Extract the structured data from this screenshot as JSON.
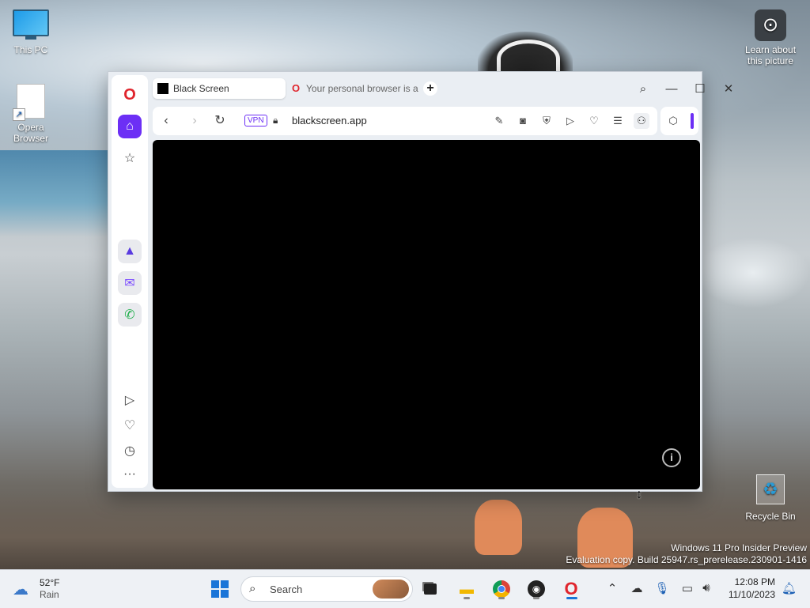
{
  "desktop": {
    "icons": [
      {
        "label": "This PC",
        "icon": "computer-icon"
      },
      {
        "label": "Opera Browser",
        "icon": "shortcut-file-icon"
      },
      {
        "label": "Learn about this picture",
        "icon": "learn-picture-icon"
      },
      {
        "label": "Recycle Bin",
        "icon": "recycle-bin-icon"
      }
    ],
    "watermark_line1": "Windows 11 Pro Insider Preview",
    "watermark_line2": "Evaluation copy. Build 25947.rs_prerelease.230901-1416"
  },
  "browser": {
    "tabs": [
      {
        "title": "Black Screen",
        "active": true
      },
      {
        "title": "Your personal browser is a",
        "active": false
      }
    ],
    "new_tab_label": "+",
    "address": {
      "vpn_label": "VPN",
      "url": "blackscreen.app"
    },
    "sidebar_icons": [
      "opera-logo-icon",
      "home-icon",
      "star-icon",
      "aria-icon",
      "messenger-icon",
      "whatsapp-icon",
      "player-icon",
      "heart-icon",
      "history-icon",
      "more-icon"
    ],
    "toolbar_icons": [
      "edit-icon",
      "camera-icon",
      "adblock-icon",
      "send-icon",
      "heart-icon",
      "settings-sliders-icon",
      "profile-icon"
    ],
    "content_background": "#000000",
    "accent": "#6c2ff5"
  },
  "taskbar": {
    "weather_temp": "52°F",
    "weather_condition": "Rain",
    "search_label": "Search",
    "apps": [
      "file-explorer-icon",
      "chrome-icon",
      "obs-icon",
      "opera-icon"
    ],
    "time": "12:08 PM",
    "date": "11/10/2023"
  }
}
